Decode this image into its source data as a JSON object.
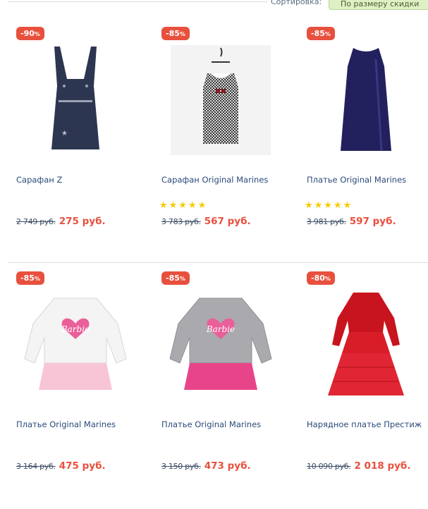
{
  "sort": {
    "label": "Сортировка:",
    "selected": "По размеру скидки"
  },
  "products": [
    {
      "badge": "-90",
      "badge_unit": "%",
      "title": "Сарафан Z",
      "old_price": "2 749 руб.",
      "new_price": "275 руб.",
      "stars": "",
      "image": "denim-pinafore"
    },
    {
      "badge": "-85",
      "badge_unit": "%",
      "title": "Сарафан Original Marines",
      "old_price": "3 783 руб.",
      "new_price": "567 руб.",
      "stars": "★★★★★",
      "image": "houndstooth-dress"
    },
    {
      "badge": "-85",
      "badge_unit": "%",
      "title": "Платье Original Marines",
      "old_price": "3 981 руб.",
      "new_price": "597 руб.",
      "stars": "★★★★★",
      "image": "navy-dress"
    },
    {
      "badge": "-85",
      "badge_unit": "%",
      "title": "Платье Original Marines",
      "old_price": "3 164 руб.",
      "new_price": "475 руб.",
      "stars": "",
      "image": "white-barbie-dress"
    },
    {
      "badge": "-85",
      "badge_unit": "%",
      "title": "Платье Original Marines",
      "old_price": "3 150 руб.",
      "new_price": "473 руб.",
      "stars": "",
      "image": "grey-barbie-dress"
    },
    {
      "badge": "-80",
      "badge_unit": "%",
      "title": "Нарядное платье Престиж",
      "old_price": "10 090 руб.",
      "new_price": "2 018 руб.",
      "stars": "",
      "image": "red-lace-gown"
    }
  ],
  "image_brand_text": "Barbie"
}
